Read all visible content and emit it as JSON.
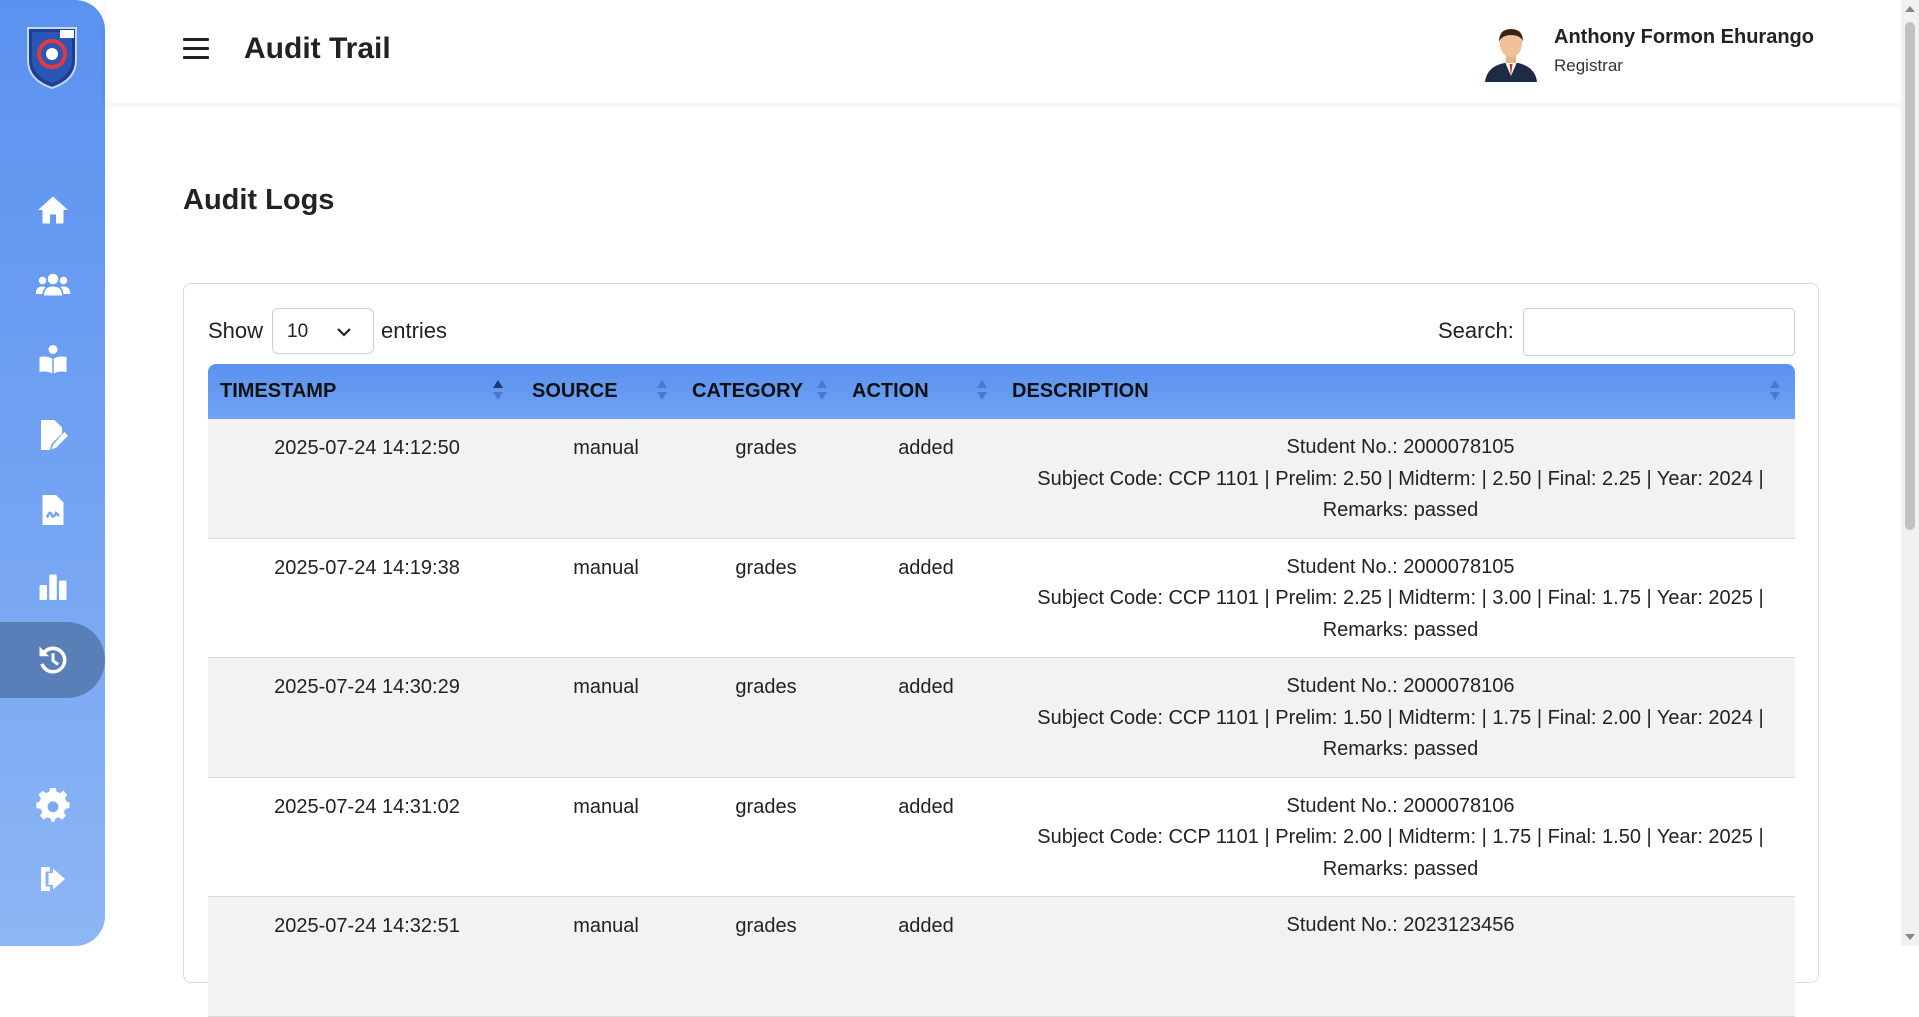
{
  "header": {
    "title": "Audit Trail",
    "user_name": "Anthony Formon Ehurango",
    "user_role": "Registrar"
  },
  "sidebar": {
    "items": [
      {
        "icon": "home-icon"
      },
      {
        "icon": "users-icon"
      },
      {
        "icon": "student-book-icon"
      },
      {
        "icon": "edit-file-icon"
      },
      {
        "icon": "signature-file-icon"
      },
      {
        "icon": "bar-chart-icon"
      },
      {
        "icon": "history-icon",
        "active": true
      },
      {
        "icon": "gear-icon"
      },
      {
        "icon": "logout-icon"
      }
    ]
  },
  "main": {
    "section_title": "Audit Logs",
    "show_label": "Show",
    "entries_value": "10",
    "entries_label": "entries",
    "search_label": "Search:",
    "search_value": ""
  },
  "table": {
    "columns": [
      "TIMESTAMP",
      "SOURCE",
      "CATEGORY",
      "ACTION",
      "DESCRIPTION"
    ],
    "rows": [
      {
        "timestamp": "2025-07-24 14:12:50",
        "source": "manual",
        "category": "grades",
        "action": "added",
        "description": "Student No.: 2000078105\nSubject Code: CCP 1101 | Prelim: 2.50 | Midterm: | 2.50 | Final: 2.25 | Year: 2024 |\nRemarks: passed"
      },
      {
        "timestamp": "2025-07-24 14:19:38",
        "source": "manual",
        "category": "grades",
        "action": "added",
        "description": "Student No.: 2000078105\nSubject Code: CCP 1101 | Prelim: 2.25 | Midterm: | 3.00 | Final: 1.75 | Year: 2025 |\nRemarks: passed"
      },
      {
        "timestamp": "2025-07-24 14:30:29",
        "source": "manual",
        "category": "grades",
        "action": "added",
        "description": "Student No.: 2000078106\nSubject Code: CCP 1101 | Prelim: 1.50 | Midterm: | 1.75 | Final: 2.00 | Year: 2024 |\nRemarks: passed"
      },
      {
        "timestamp": "2025-07-24 14:31:02",
        "source": "manual",
        "category": "grades",
        "action": "added",
        "description": "Student No.: 2000078106\nSubject Code: CCP 1101 | Prelim: 2.00 | Midterm: | 1.75 | Final: 1.50 | Year: 2025 |\nRemarks: passed"
      },
      {
        "timestamp": "2025-07-24 14:32:51",
        "source": "manual",
        "category": "grades",
        "action": "added",
        "description": "Student No.: 2023123456"
      }
    ]
  },
  "colors": {
    "sidebar_top": "#5b92f0",
    "sidebar_bottom": "#8db6f5",
    "active_nav": "#5a7fb8",
    "table_header": "#5b92f0",
    "row_stripe": "#f2f2f2"
  }
}
